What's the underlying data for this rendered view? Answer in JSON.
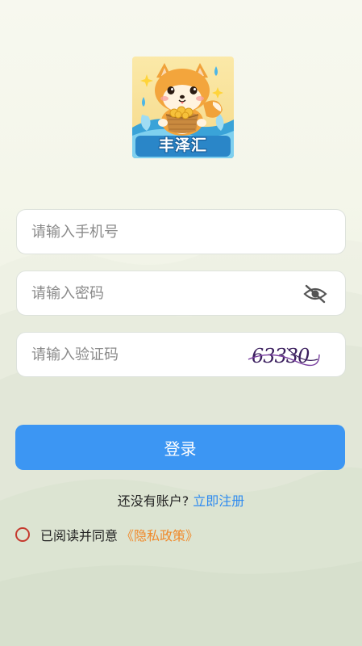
{
  "app": {
    "name": "丰泽汇"
  },
  "login_form": {
    "phone_placeholder": "请输入手机号",
    "password_placeholder": "请输入密码",
    "captcha_placeholder": "请输入验证码",
    "captcha_code": "63330",
    "password_toggle_icon": "eye-off-icon",
    "submit_label": "登录"
  },
  "register": {
    "prompt": "还没有账户?",
    "link": "立即注册"
  },
  "agreement": {
    "text": "已阅读并同意",
    "link": "《隐私政策》",
    "checked": false
  },
  "colors": {
    "primary": "#3c96f3",
    "link": "#2f8bf0",
    "privacy_link": "#f08a2c",
    "radio_border": "#c5392e"
  }
}
